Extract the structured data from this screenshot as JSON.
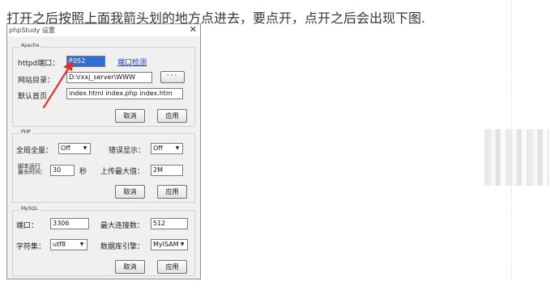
{
  "caption": "打开之后按照上面我箭头划的地方点进去，要点开，点开之后会出现下图.",
  "window": {
    "title": "phpStudy 设置",
    "close_glyph": "✕",
    "apache": {
      "legend": "Apache",
      "port_label": "httpd端口：",
      "port_value": "8052",
      "port_check_link": "端口检测",
      "root_label": "网站目录：",
      "root_value": "D:\\rxxj_server\\WWW",
      "browse_label": "···",
      "index_label": "默认首页",
      "index_value": "index.html index.php index.htm",
      "cancel": "取消",
      "apply": "应用"
    },
    "php": {
      "legend": "PHP",
      "globals_label": "全局全量：",
      "globals_value": "Off",
      "errors_label": "错误显示：",
      "errors_value": "Off",
      "exec_label_line1": "脚本运行",
      "exec_label_line2": "最长时间：",
      "exec_value": "30",
      "exec_unit": "秒",
      "upload_label": "上传最大值：",
      "upload_value": "2M",
      "cancel": "取消",
      "apply": "应用"
    },
    "mysql": {
      "legend": "MySQL",
      "port_label": "端口：",
      "port_value": "3306",
      "maxconn_label": "最大连接数：",
      "maxconn_value": "512",
      "charset_label": "字符集：",
      "charset_value": "utf8",
      "engine_label": "数据库引擎：",
      "engine_value": "MyISAM",
      "cancel": "取消",
      "apply": "应用"
    }
  },
  "colors": {
    "annotation_arrow": "#e0332f",
    "selection": "#2f6fd6",
    "link": "#1a3fb5"
  },
  "icons": {
    "dropdown": "chevron-down-icon",
    "close": "close-icon"
  }
}
